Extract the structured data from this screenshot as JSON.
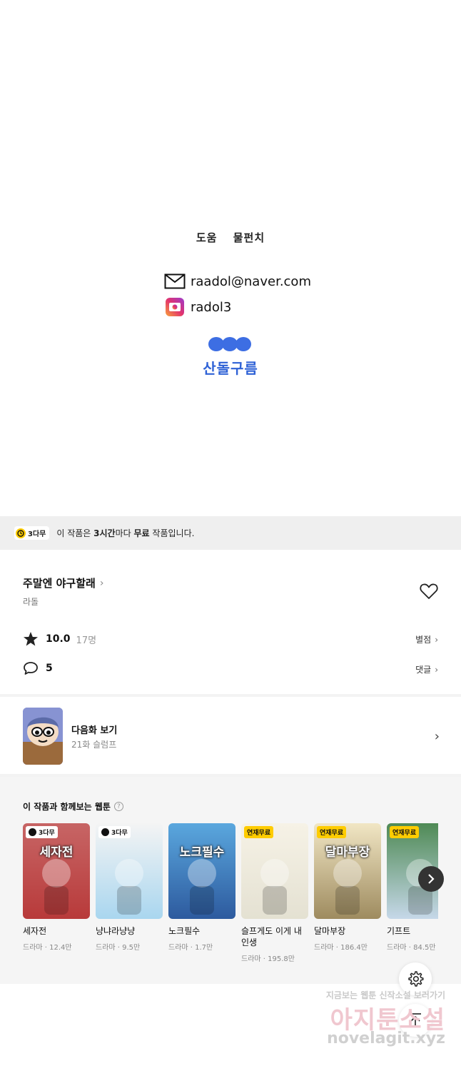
{
  "credits": {
    "helpers": [
      "도움",
      "물펀치"
    ],
    "email": "raadol@naver.com",
    "instagram": "radol3",
    "publisher": "산돌구름"
  },
  "notice": {
    "badge": "3다무",
    "text_pre": "이 작품은 ",
    "text_hours": "3시간",
    "text_mid": "마다 ",
    "text_free": "무료",
    "text_post": " 작품입니다."
  },
  "work": {
    "title": "주말엔 야구할래",
    "author": "라돌",
    "rating": "10.0",
    "rating_count": "17명",
    "rating_link": "별점",
    "comments": "5",
    "comments_link": "댓글"
  },
  "next_episode": {
    "label": "다음화 보기",
    "subtitle": "21화 슬럼프"
  },
  "recommend": {
    "title": "이 작품과 함께보는 웹툰",
    "items": [
      {
        "name": "세자전",
        "meta": "드라마 · 12.4만",
        "tag": "3다무",
        "cover_title": "세자전",
        "color_top": "#c76565",
        "color_bottom": "#b83a3a"
      },
      {
        "name": "냥냐라냥냥",
        "meta": "드라마 · 9.5만",
        "tag": "3다무",
        "cover_title": "",
        "color_top": "#f4f4f4",
        "color_bottom": "#a9d6ef"
      },
      {
        "name": "노크필수",
        "meta": "드라마 · 1.7만",
        "tag": "",
        "cover_title": "노크필수",
        "color_top": "#5aa7de",
        "color_bottom": "#2d5a9e"
      },
      {
        "name": "슬프게도 이게 내 인생",
        "meta": "드라마 · 195.8만",
        "tag": "연재무료",
        "cover_title": "",
        "color_top": "#f6f2e6",
        "color_bottom": "#e4e1d2"
      },
      {
        "name": "달마부장",
        "meta": "드라마 · 186.4만",
        "tag": "연재무료",
        "cover_title": "달마부장",
        "color_top": "#f1e6c4",
        "color_bottom": "#9e8b5f"
      },
      {
        "name": "기프트",
        "meta": "드라마 · 84.5만",
        "tag": "연재무료",
        "cover_title": "",
        "color_top": "#4f8a55",
        "color_bottom": "#c6d8e9"
      }
    ]
  },
  "watermark": {
    "line1": "지금보는 웹툰 신작소설 보러가기",
    "line2": "아지툰소설",
    "line3": "novelagit.xyz"
  },
  "colors": {
    "accent": "#2f62d6",
    "badge_yellow": "#ffcc00",
    "notice_bg": "#efefef"
  }
}
